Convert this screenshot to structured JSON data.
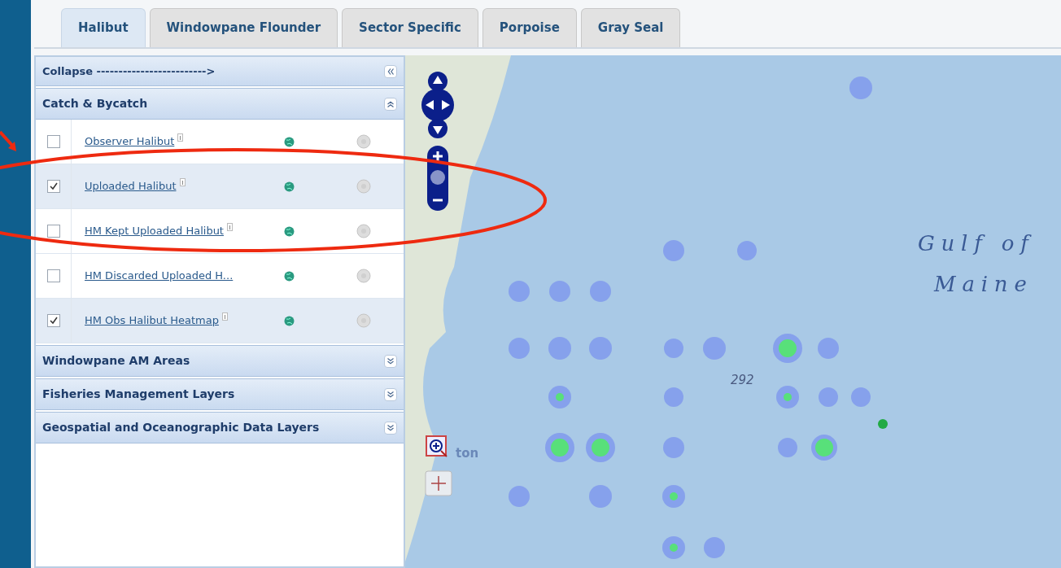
{
  "tabs": [
    {
      "label": "Halibut",
      "selected": true
    },
    {
      "label": "Windowpane Flounder",
      "selected": false
    },
    {
      "label": "Sector Specific",
      "selected": false
    },
    {
      "label": "Porpoise",
      "selected": false
    },
    {
      "label": "Gray Seal",
      "selected": false
    }
  ],
  "sidebar": {
    "collapse_label": "Collapse ------------------------->",
    "sections": [
      {
        "title": "Catch & Bycatch",
        "expanded": true,
        "layers": [
          {
            "name": "Observer Halibut",
            "checked": false,
            "info": true
          },
          {
            "name": "Uploaded Halibut",
            "checked": true,
            "info": true
          },
          {
            "name": "HM Kept Uploaded Halibut",
            "checked": false,
            "info": true
          },
          {
            "name": "HM Discarded Uploaded H...",
            "checked": false,
            "info": false
          },
          {
            "name": "HM Obs Halibut Heatmap",
            "checked": true,
            "info": true
          }
        ]
      },
      {
        "title": "Windowpane AM Areas",
        "expanded": false
      },
      {
        "title": "Fisheries Management Layers",
        "expanded": false
      },
      {
        "title": "Geospatial and Oceanographic Data Layers",
        "expanded": false
      }
    ]
  },
  "map": {
    "labels": [
      {
        "text": "Gulf of",
        "kind": "region"
      },
      {
        "text": "Maine",
        "kind": "region"
      },
      {
        "text": "292",
        "kind": "depth"
      },
      {
        "text": "ton",
        "kind": "place"
      }
    ]
  }
}
